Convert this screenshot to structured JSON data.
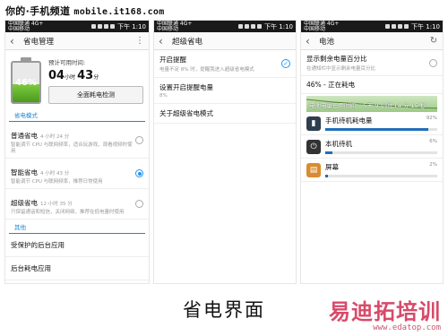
{
  "site": {
    "name": "你的·手机频道",
    "url": "mobile.it168.com"
  },
  "status_bar": {
    "carrier_line1": "中国联通 4G+",
    "carrier_line2": "中国移动",
    "time": "下午 1:10"
  },
  "panel1": {
    "title": "省电管理",
    "menu_icon": "more-vert-icon",
    "battery_percent": 46,
    "battery_label": "46%",
    "estimate_label": "预计可用时间:",
    "hours": "04",
    "hours_unit": "小时",
    "minutes": "43",
    "minutes_unit": "分",
    "check_button": "全面耗电检测",
    "modes_header": "省电模式",
    "modes": [
      {
        "name": "普通省电",
        "hours": "4 小时 24 分",
        "desc": "智能调节 CPU 与联网频率，适合玩游戏，观看视频时使用",
        "selected": false
      },
      {
        "name": "智能省电",
        "hours": "4 小时 43 分",
        "desc": "智能调节 CPU 与联网频率，推荐日常使用",
        "selected": true
      },
      {
        "name": "超级省电",
        "hours": "12 小时 35 分",
        "desc": "只保留通话和短信，关闭网络，推荐在低电量时使用",
        "selected": false
      }
    ],
    "other_header": "其他",
    "other_items": [
      "受保护的后台应用",
      "后台耗电应用"
    ]
  },
  "panel2": {
    "title": "超级省电",
    "items": [
      {
        "name": "开启提醒",
        "desc": "电量不足 8% 时，提醒我进入超级省电模式",
        "checked": true
      },
      {
        "name": "设置开启提醒电量",
        "desc": "8%"
      },
      {
        "name": "关于超级省电模式",
        "desc": ""
      }
    ]
  },
  "panel3": {
    "title": "电池",
    "refresh_icon": "refresh-icon",
    "show_percent": {
      "name": "显示剩余电量百分比",
      "desc": "在通知栏中显示剩余电量百分比"
    },
    "status": "46% - 正在耗电",
    "usage_time": "电池电量已用时间： 5天 9 小时 14 分 15 秒",
    "apps": [
      {
        "name": "手机待机耗电量",
        "percent_label": "92%",
        "percent": 92,
        "icon": "signal-icon",
        "color": "#2d3e4f"
      },
      {
        "name": "本机待机",
        "percent_label": "6%",
        "percent": 6,
        "icon": "power-icon",
        "color": "#333333"
      },
      {
        "name": "屏幕",
        "percent_label": "2%",
        "percent": 2,
        "icon": "screen-icon",
        "color": "#d98c2f"
      }
    ]
  },
  "caption": "省电界面",
  "watermark": {
    "brand": "易迪拓培训",
    "url": "www.edatop.com"
  }
}
